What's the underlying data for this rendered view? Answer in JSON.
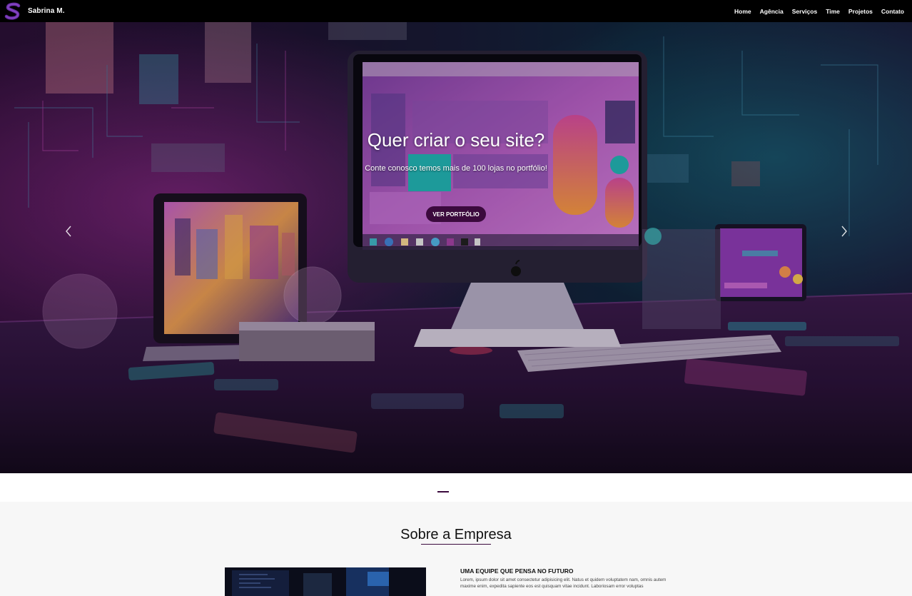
{
  "brand": {
    "name": "Sabrina M.",
    "logo_icon": "s-logo-icon",
    "logo_color": "#6b2fa8"
  },
  "nav": {
    "items": [
      {
        "label": "Home"
      },
      {
        "label": "Agência"
      },
      {
        "label": "Serviços"
      },
      {
        "label": "Time"
      },
      {
        "label": "Projetos"
      },
      {
        "label": "Contato"
      }
    ]
  },
  "hero": {
    "title": "Quer criar o seu site?",
    "subtitle": "Conte conosco temos mais de 100 lojas no portfólio!",
    "button_label": "VER PORTFÓLIO",
    "prev_icon": "chevron-left-icon",
    "next_icon": "chevron-right-icon",
    "accent_color": "#3b0a3d"
  },
  "about": {
    "title": "Sobre a Empresa",
    "heading": "UMA EQUIPE QUE PENSA NO FUTURO",
    "text": "Lorem, ipsum dolor sit amet consectetur adipisicing elit. Natus et quidem voluptatem nam, omnis autem maxime enim, expedita sapiente eos est quisquam vitae incidunt. Laboriosam error voluptas"
  }
}
